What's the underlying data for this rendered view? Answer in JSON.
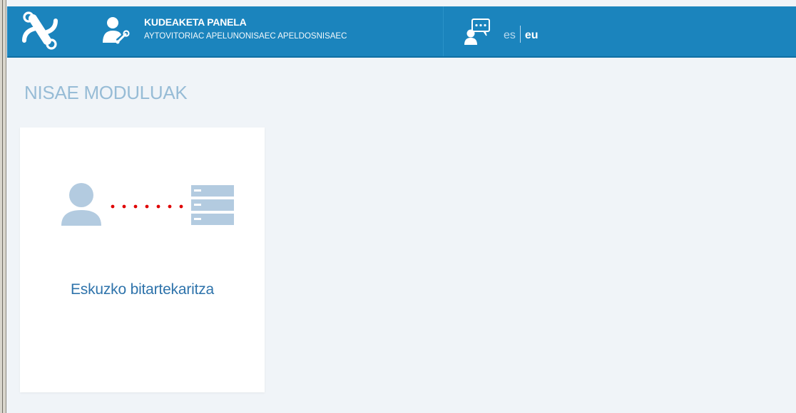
{
  "header": {
    "panel_title": "KUDEAKETA PANELA",
    "user_name": "AYTOVITORIAC APELUNONISAEC APELDOSNISAEC",
    "icons": {
      "logo": "app-logo-icon",
      "admin": "admin-user-icon",
      "chat": "chat-support-icon"
    }
  },
  "languages": {
    "es": "es",
    "eu": "eu",
    "active": "eu"
  },
  "main": {
    "heading": "NISAE MODULUAK",
    "modules": [
      {
        "label": "Eskuzko bitartekaritza",
        "icon": "user-to-server-icon"
      }
    ]
  },
  "colors": {
    "header_bg": "#1b84bd",
    "page_bg": "#f0f4f8",
    "heading": "#97bcd6",
    "module_label": "#2e73ab",
    "connector_dots": "#e00000",
    "illustration": "#b3cbe0"
  }
}
